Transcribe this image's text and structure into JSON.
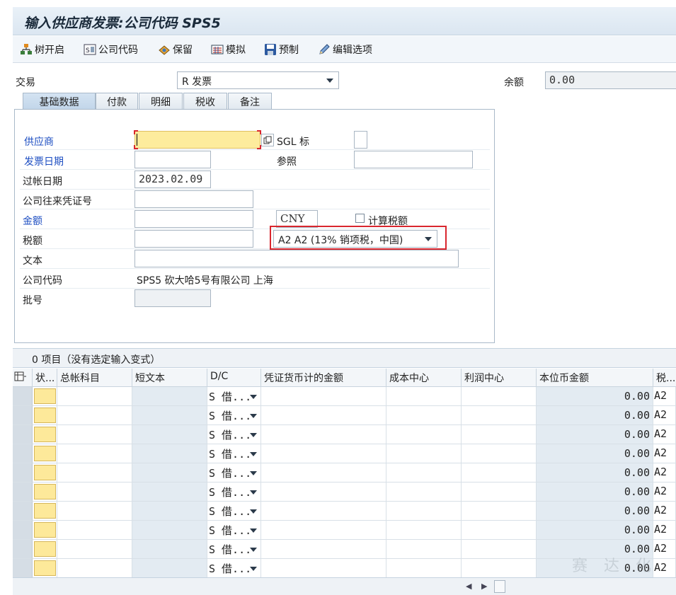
{
  "title": "输入供应商发票:公司代码 SPS5",
  "toolbar": {
    "tree_open": "树开启",
    "company_code": "公司代码",
    "hold": "保留",
    "simulate": "模拟",
    "park": "预制",
    "edit_options": "编辑选项"
  },
  "transaction": {
    "label": "交易",
    "value": "R 发票"
  },
  "balance": {
    "label": "余额",
    "value": "0.00"
  },
  "tabs": [
    "基础数据",
    "付款",
    "明细",
    "税收",
    "备注"
  ],
  "form": {
    "vendor_label": "供应商",
    "vendor_value": "",
    "sgl_label": "SGL 标",
    "sgl_value": "",
    "invoice_date_label": "发票日期",
    "invoice_date_value": "",
    "reference_label": "参照",
    "reference_value": "",
    "posting_date_label": "过帐日期",
    "posting_date_value": "2023.02.09",
    "cross_cc_label": "公司往来凭证号",
    "cross_cc_value": "",
    "amount_label": "金额",
    "amount_value": "",
    "currency_value": "CNY",
    "calc_tax_label": "计算税额",
    "tax_amount_label": "税额",
    "tax_amount_value": "",
    "tax_code_value": "A2 A2 (13% 销项税，中国)",
    "text_label": "文本",
    "text_value": "",
    "company_code_label": "公司代码",
    "company_code_value": "SPS5 砍大哈5号有限公司 上海",
    "batch_label": "批号",
    "batch_value": ""
  },
  "grid": {
    "summary": "0 项目（没有选定输入变式）",
    "columns": [
      "状...",
      "总帐科目",
      "短文本",
      "D/C",
      "凭证货币计的金额",
      "成本中心",
      "利润中心",
      "本位币金额",
      "税..."
    ],
    "rows": [
      {
        "dc": "S 借...",
        "local_amount": "0.00",
        "tax": "A2"
      },
      {
        "dc": "S 借...",
        "local_amount": "0.00",
        "tax": "A2"
      },
      {
        "dc": "S 借...",
        "local_amount": "0.00",
        "tax": "A2"
      },
      {
        "dc": "S 借...",
        "local_amount": "0.00",
        "tax": "A2"
      },
      {
        "dc": "S 借...",
        "local_amount": "0.00",
        "tax": "A2"
      },
      {
        "dc": "S 借...",
        "local_amount": "0.00",
        "tax": "A2"
      },
      {
        "dc": "S 借...",
        "local_amount": "0.00",
        "tax": "A2"
      },
      {
        "dc": "S 借...",
        "local_amount": "0.00",
        "tax": "A2"
      },
      {
        "dc": "S 借...",
        "local_amount": "0.00",
        "tax": "A2"
      },
      {
        "dc": "S 借...",
        "local_amount": "0.00",
        "tax": "A2"
      }
    ]
  },
  "watermark": "赛 达 化"
}
